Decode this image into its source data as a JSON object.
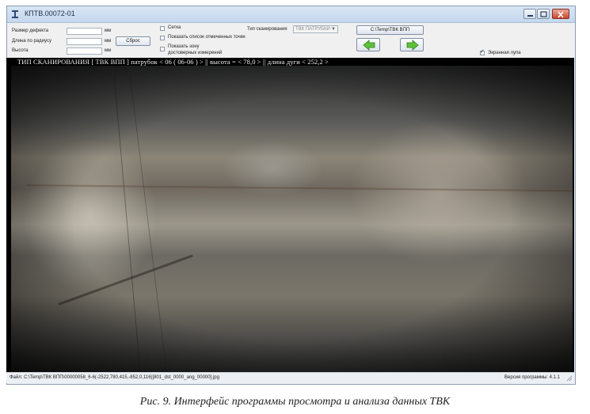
{
  "window": {
    "title": "КПТВ.00072-01"
  },
  "controls": {
    "defect_size_label": "Размер дефекта",
    "defect_size_unit": "мм",
    "radius_length_label": "Длина по радиусу",
    "radius_length_unit": "мм",
    "height_label": "Высота",
    "height_unit": "мм",
    "reset_button": "Сброс",
    "grid_checkbox": "Сетка",
    "show_points_checkbox": "Показать список отмеченных точек",
    "show_zone_checkbox_line1": "Показать зону",
    "show_zone_checkbox_line2": "достоверных измерений",
    "scan_type_label": "Тип сканирования",
    "scan_type_value": "ТВК ПАТРУБКИ",
    "path_button": "C:\\Temp\\ТВК ВПП",
    "screen_magnifier_checkbox": "Экранная лупа",
    "screen_magnifier_checked": true
  },
  "viewer": {
    "overlay_text": "ТИП СКАНИРОВАНИЯ [ ТВК ВПП ] патрубок < 06 ( 06-06 ) > || высота = < 78,0 > || длина дуги < 252,2 >"
  },
  "status": {
    "file": "Файл: C:\\Temp\\ТВК ВПП\\00000058_6-6(-2522,780,415,-852,0,116)]801_dst_0000_ang_00000].jpg",
    "version": "Версия программы: 4.1.1"
  },
  "caption": "Рис. 9. Интерфейс программы просмотра и анализа данных ТВК"
}
